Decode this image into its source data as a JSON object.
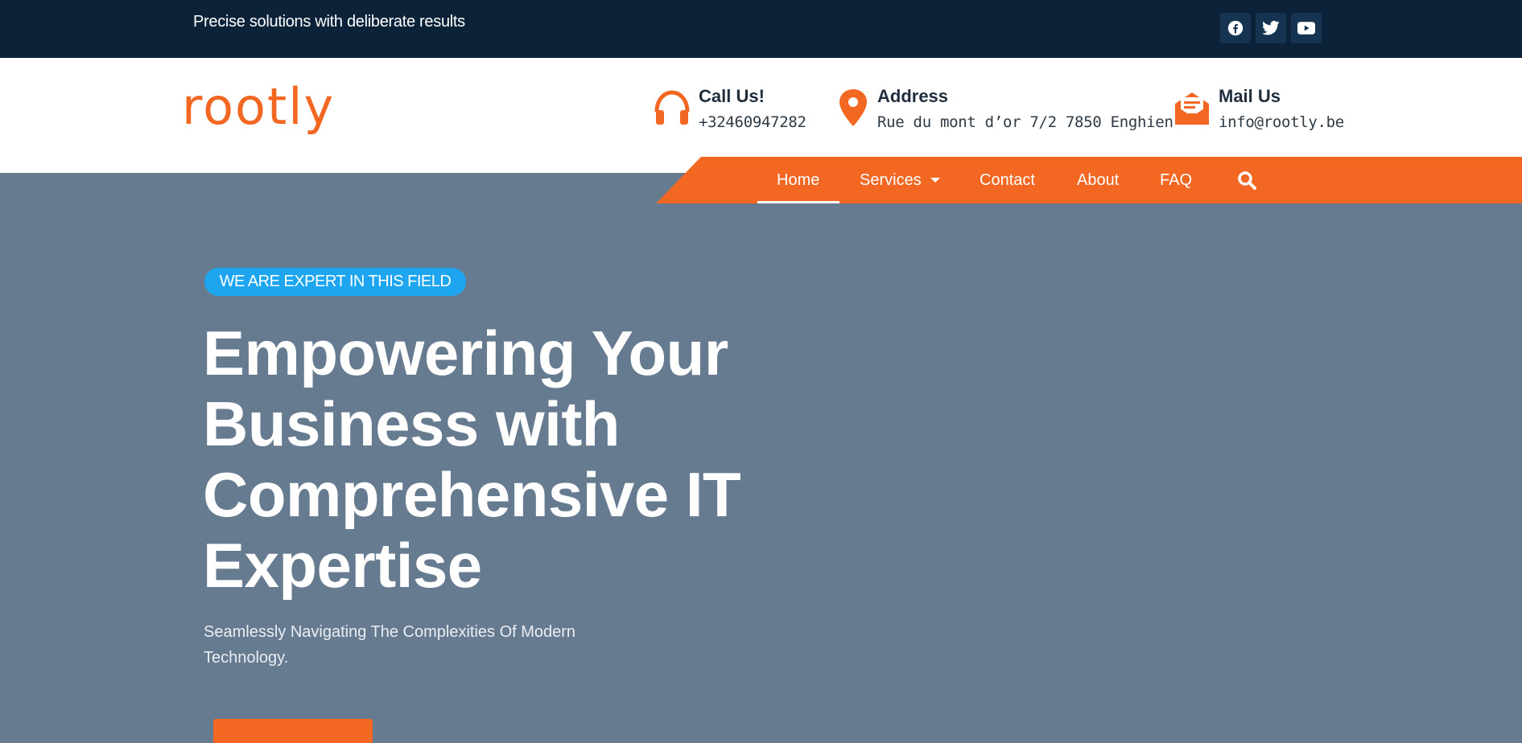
{
  "topbar": {
    "tagline": "Precise solutions with deliberate results",
    "social": [
      {
        "icon": "facebook-icon"
      },
      {
        "icon": "twitter-icon"
      },
      {
        "icon": "youtube-icon"
      }
    ]
  },
  "header": {
    "logo": "rootly",
    "contacts": [
      {
        "icon": "headphones-icon",
        "title": "Call Us!",
        "value": "+32460947282"
      },
      {
        "icon": "map-pin-icon",
        "title": "Address",
        "value": "Rue du mont d’or 7/2 7850 Enghien"
      },
      {
        "icon": "mail-open-icon",
        "title": "Mail Us",
        "value": "info@rootly.be"
      }
    ]
  },
  "nav": {
    "items": [
      "Home",
      "Services",
      "Contact",
      "About",
      "FAQ"
    ],
    "active": "Home",
    "search_icon": "search-icon"
  },
  "hero": {
    "badge": "WE ARE EXPERT IN THIS FIELD",
    "title_lines": [
      "Empowering Your",
      "Business with",
      "Comprehensive IT",
      "Expertise"
    ],
    "subtitle_lines": [
      "Seamlessly Navigating The Complexities Of Modern",
      "Technology."
    ]
  },
  "colors": {
    "topbar": "#0b2239",
    "accent": "#f26722",
    "badge": "#1da6ef",
    "hero_bg": "#677b90"
  }
}
